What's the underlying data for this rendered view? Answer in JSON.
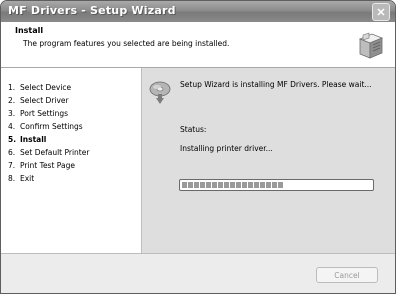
{
  "window": {
    "title": "MF Drivers - Setup Wizard"
  },
  "header": {
    "title": "Install",
    "subtitle": "The program features you selected are being installed."
  },
  "steps": [
    {
      "number": "1.",
      "label": "Select Device",
      "current": false
    },
    {
      "number": "2.",
      "label": "Select Driver",
      "current": false
    },
    {
      "number": "3.",
      "label": "Port Settings",
      "current": false
    },
    {
      "number": "4.",
      "label": "Confirm Settings",
      "current": false
    },
    {
      "number": "5.",
      "label": "Install",
      "current": true
    },
    {
      "number": "6.",
      "label": "Set Default Printer",
      "current": false
    },
    {
      "number": "7.",
      "label": "Print Test Page",
      "current": false
    },
    {
      "number": "8.",
      "label": "Exit",
      "current": false
    }
  ],
  "main": {
    "message": "Setup Wizard is installing MF Drivers. Please wait...",
    "status_label": "Status:",
    "status_text": "Installing printer driver...",
    "progress_fraction": 0.55
  },
  "footer": {
    "cancel_label": "Cancel"
  },
  "icons": {
    "header_icon": "software-box-icon",
    "install_icon": "installer-disc-icon",
    "close_icon": "close-icon"
  }
}
